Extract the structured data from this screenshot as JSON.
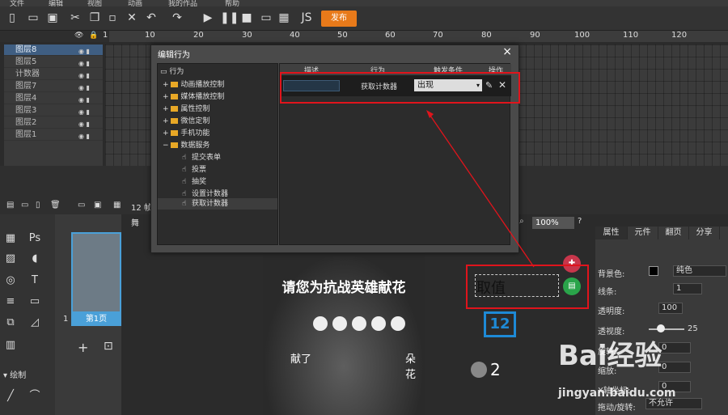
{
  "menu": [
    "文件",
    "编辑",
    "视图",
    "动画",
    "我的作品",
    "帮助"
  ],
  "toolbar": {
    "publish_label": "发布"
  },
  "timeline": {
    "ruler_ticks": [
      "1",
      "10",
      "20",
      "30",
      "40",
      "50",
      "60",
      "70",
      "80",
      "90",
      "100",
      "110",
      "120"
    ],
    "layers": [
      "图层8",
      "图层5",
      "计数器",
      "图层7",
      "图层4",
      "图层3",
      "图层2",
      "图层1"
    ],
    "selected_layer": "图层8",
    "frames_label": "12 帧"
  },
  "left_panel": {
    "icons": [
      "grid-icon",
      "ps-icon",
      "image-icon",
      "sound-icon",
      "film-icon",
      "text-icon",
      "list-icon",
      "presentation-icon",
      "code-icon",
      "chart-icon",
      "barcode-icon"
    ],
    "ps_label": "Ps",
    "draw_label": "绘制"
  },
  "pages": {
    "index": "1",
    "thumb_label": "第1页"
  },
  "canvas": {
    "tab_label": "舞",
    "zoom": "100%",
    "title": "请您为抗战英雄献花",
    "left_text": "献了",
    "right_text": "朵花",
    "value_label": "取值",
    "count_value": "2"
  },
  "dialog": {
    "title": "编辑行为",
    "tree_root": "行为",
    "folders": [
      "动画播放控制",
      "媒体播放控制",
      "属性控制",
      "微信定制",
      "手机功能",
      "数据服务"
    ],
    "items": [
      "提交表单",
      "投票",
      "抽奖",
      "设置计数器",
      "获取计数器"
    ],
    "selected_item": "获取计数器",
    "columns": [
      "描述",
      "行为",
      "触发条件",
      "操作"
    ],
    "row": {
      "action": "获取计数器",
      "trigger": "出现"
    }
  },
  "right_panel": {
    "tabs": [
      "属性",
      "元件",
      "翻页",
      "分享"
    ],
    "bg_label": "背景色:",
    "bg_fill": "纯色",
    "line_label": "线条:",
    "line_value": "1",
    "opacity_label": "透明度:",
    "opacity_value": "100",
    "blur_label": "透视度:",
    "blur_value": "25",
    "rotate_label": "旋转:",
    "rotate_value": "0",
    "scale_label": "缩放:",
    "scale_value": "0",
    "x_label": "X轴坐标:",
    "x_value": "0",
    "drag_label": "拖动/旋转:",
    "drag_value": "不允许"
  },
  "watermark": {
    "brand": "Bai经验",
    "url": "jingyan.baidu.com"
  },
  "colors": {
    "accent": "#e87a1a",
    "highlight": "#e0141c",
    "selection": "#3f5e82"
  }
}
